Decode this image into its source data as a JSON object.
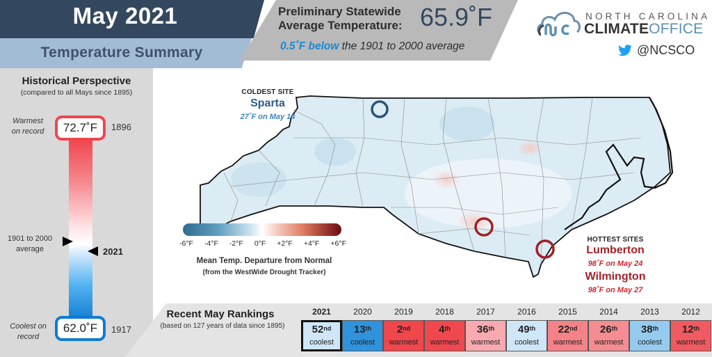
{
  "header": {
    "title": "May 2021",
    "subtitle": "Temperature Summary",
    "prelim_label_line1": "Preliminary Statewide",
    "prelim_label_line2": "Average Temperature:",
    "avg_temperature": "65.9˚F",
    "departure_value": "0.5˚F below",
    "departure_rest": " the 1901 to 2000 average"
  },
  "logo": {
    "line1": "NORTH CAROLINA",
    "line2_bold": "CLIMATE",
    "line2_light": "OFFICE",
    "twitter_icon": "twitter-bird-icon",
    "twitter_handle": "@NCSCO"
  },
  "historical": {
    "title": "Historical Perspective",
    "subtitle": "(compared to all Mays since 1895)",
    "warmest": {
      "label_line1": "Warmest",
      "label_line2": "on record",
      "value": "72.7˚F",
      "year": "1896"
    },
    "coolest": {
      "label_line1": "Coolest on",
      "label_line2": "record",
      "value": "62.0˚F",
      "year": "1917"
    },
    "average_label_line1": "1901 to 2000",
    "average_label_line2": "average",
    "current_year": "2021",
    "colors": {
      "warm": "#ef464d",
      "cool": "#0f7bd0"
    }
  },
  "map": {
    "coldest": {
      "header": "COLDEST SITE",
      "name": "Sparta",
      "detail": "27˚F on May 14",
      "color": "#2b5d8d"
    },
    "hottest": {
      "header": "HOTTEST SITES",
      "sites": [
        {
          "name": "Lumberton",
          "detail": "98˚F on May 24"
        },
        {
          "name": "Wilmington",
          "detail": "98˚F on May 27"
        }
      ],
      "color": "#a4222a"
    },
    "legend": {
      "ticks": [
        "-6°F",
        "-4°F",
        "-2°F",
        "0°F",
        "+2°F",
        "+4°F",
        "+6°F"
      ],
      "title": "Mean Temp. Departure from Normal",
      "subtitle": "(from the WestWide Drought Tracker)"
    }
  },
  "rankings": {
    "title": "Recent May Rankings",
    "subtitle": "(based on 127 years of data since 1895)",
    "items": [
      {
        "year": "2021",
        "rank": "52",
        "suffix": "nd",
        "label": "coolest",
        "color": "#cfe6f8",
        "current": true
      },
      {
        "year": "2020",
        "rank": "13",
        "suffix": "th",
        "label": "coolest",
        "color": "#2e93dc",
        "current": false
      },
      {
        "year": "2019",
        "rank": "2",
        "suffix": "nd",
        "label": "warmest",
        "color": "#f0464c",
        "current": false
      },
      {
        "year": "2018",
        "rank": "4",
        "suffix": "th",
        "label": "warmest",
        "color": "#f0484e",
        "current": false
      },
      {
        "year": "2017",
        "rank": "36",
        "suffix": "th",
        "label": "warmest",
        "color": "#f8aab0",
        "current": false
      },
      {
        "year": "2016",
        "rank": "49",
        "suffix": "th",
        "label": "coolest",
        "color": "#cfe6f8",
        "current": false
      },
      {
        "year": "2015",
        "rank": "22",
        "suffix": "nd",
        "label": "warmest",
        "color": "#f58287",
        "current": false
      },
      {
        "year": "2014",
        "rank": "26",
        "suffix": "th",
        "label": "warmest",
        "color": "#f58c91",
        "current": false
      },
      {
        "year": "2013",
        "rank": "38",
        "suffix": "th",
        "label": "coolest",
        "color": "#95cbef",
        "current": false
      },
      {
        "year": "2012",
        "rank": "12",
        "suffix": "th",
        "label": "warmest",
        "color": "#f05a60",
        "current": false
      }
    ]
  }
}
